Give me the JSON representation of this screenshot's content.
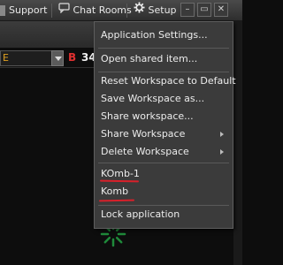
{
  "toolbar": {
    "support_label": "Support",
    "chat_rooms_label": "Chat Rooms",
    "setup_label": "Setup",
    "minimize_symbol": "–",
    "restore_symbol": "▭",
    "close_symbol": "✕"
  },
  "order_panel": {
    "symbol_value": "E",
    "alert_text": "B",
    "size_value": "34"
  },
  "setup_menu": {
    "items": [
      {
        "label": "Application Settings..."
      },
      {
        "label": "Open shared item..."
      },
      {
        "label": "Reset Workspace to Default"
      },
      {
        "label": "Save Workspace as..."
      },
      {
        "label": "Share workspace..."
      },
      {
        "label": "Share Workspace",
        "submenu": true
      },
      {
        "label": "Delete Workspace",
        "submenu": true
      },
      {
        "label": "KOmb-1"
      },
      {
        "label": "Komb"
      },
      {
        "label": "Lock application"
      }
    ]
  },
  "annotation": {
    "underline_color": "#d8202a"
  },
  "icons": {
    "support": "support-icon",
    "chat": "chat-bubble-icon",
    "setup": "gear-icon",
    "loading": "spinner-icon"
  }
}
